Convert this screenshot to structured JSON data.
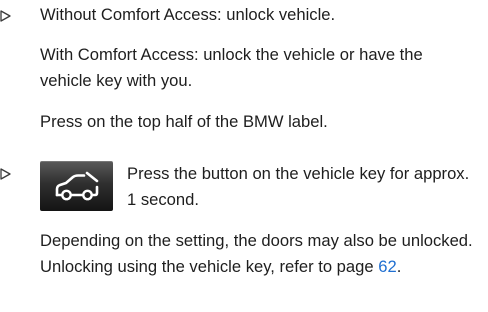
{
  "steps": [
    {
      "paragraphs": [
        "Without Comfort Access: unlock vehicle.",
        "With Comfort Access: unlock the vehicle or have the vehicle key with you.",
        "Press on the top half of the BMW label."
      ]
    },
    {
      "icon": "trunk-lid-key-button-icon",
      "button_text": "Press the button on the vehicle key for approx. 1 second.",
      "note_prefix": "Depending on the setting, the doors may also be unlocked. Unlocking using the vehicle key, refer to page ",
      "page_link": "62",
      "note_suffix": "."
    }
  ],
  "colors": {
    "text": "#1e1e1e",
    "bullet": "#3a3a3a",
    "link": "#1f6fd1"
  }
}
